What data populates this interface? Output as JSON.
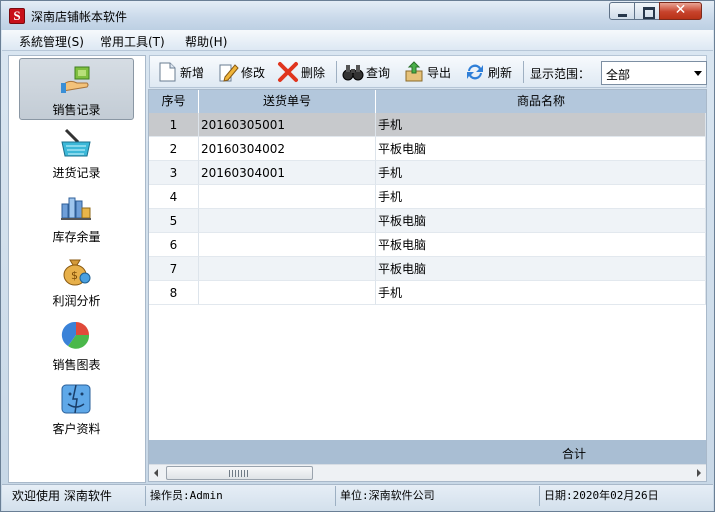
{
  "window": {
    "title": "深南店铺帐本软件",
    "icon_letter": "S"
  },
  "menu": [
    {
      "label": "系統管理(S)"
    },
    {
      "label": "常用工具(T)"
    },
    {
      "label": "帮助(H)"
    }
  ],
  "sidebar": {
    "items": [
      {
        "label": "销售记录",
        "icon": "sales-hand-icon",
        "active": true
      },
      {
        "label": "进货记录",
        "icon": "basket-icon",
        "active": false
      },
      {
        "label": "库存余量",
        "icon": "inventory-chart-icon",
        "active": false
      },
      {
        "label": "利润分析",
        "icon": "money-bag-icon",
        "active": false
      },
      {
        "label": "销售图表",
        "icon": "pie-chart-icon",
        "active": false
      },
      {
        "label": "客户资料",
        "icon": "finder-face-icon",
        "active": false
      }
    ]
  },
  "toolbar": {
    "new": "新增",
    "edit": "修改",
    "delete": "删除",
    "query": "查询",
    "export": "导出",
    "refresh": "刷新",
    "range_label": "显示范围：",
    "range_value": "全部"
  },
  "table": {
    "columns": [
      "序号",
      "送货单号",
      "商品名称"
    ],
    "rows": [
      {
        "idx": "1",
        "order_no": "20160305001",
        "product": "手机"
      },
      {
        "idx": "2",
        "order_no": "20160304002",
        "product": "平板电脑"
      },
      {
        "idx": "3",
        "order_no": "20160304001",
        "product": "手机"
      },
      {
        "idx": "4",
        "order_no": "",
        "product": "手机"
      },
      {
        "idx": "5",
        "order_no": "",
        "product": "平板电脑"
      },
      {
        "idx": "6",
        "order_no": "",
        "product": "平板电脑"
      },
      {
        "idx": "7",
        "order_no": "",
        "product": "平板电脑"
      },
      {
        "idx": "8",
        "order_no": "",
        "product": "手机"
      }
    ],
    "footer_label": "合计",
    "scroll_grip": "III"
  },
  "status": {
    "welcome": "欢迎使用 深南软件",
    "operator": "操作员:Admin",
    "unit": "单位:深南软件公司",
    "date": "日期:2020年02月26日"
  },
  "colors": {
    "header": "#b3c7dc",
    "selected_row": "#c7c9cc",
    "close_button": "#c7432c"
  }
}
